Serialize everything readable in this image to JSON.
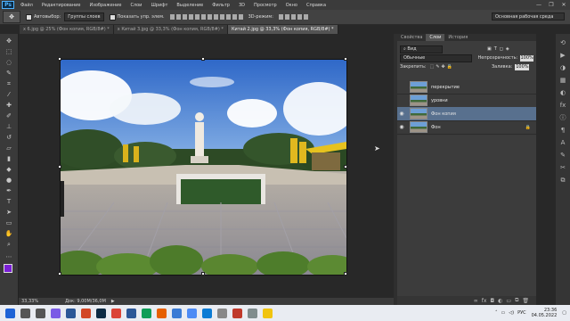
{
  "app": {
    "logo": "Ps"
  },
  "menu": [
    "Файл",
    "Редактирование",
    "Изображение",
    "Слои",
    "Шрифт",
    "Выделение",
    "Фильтр",
    "3D",
    "Просмотр",
    "Окно",
    "Справка"
  ],
  "window_controls": [
    "—",
    "❐",
    "✕"
  ],
  "options": {
    "autoselect_label": "Автовыбор:",
    "autoselect_value": "Группы слоев",
    "show_transform_label": "Показать упр. элем.",
    "mode3d_label": "3D-режим:",
    "workspace": "Основная рабочая среда"
  },
  "doc_tabs": [
    {
      "label": "х 6.jpg @ 25% (Фон копия, RGB/8#) *",
      "active": false
    },
    {
      "label": "х Китай 3.jpg @ 33,3% (Фон копия, RGB/8#) *",
      "active": false
    },
    {
      "label": "Китай 2.jpg @ 33,3% (Фон копия, RGB/8#) *",
      "active": true
    }
  ],
  "status": {
    "zoom": "33,33%",
    "doc": "Док: 9,00M/36,0M"
  },
  "panel": {
    "tabs": [
      "Свойства",
      "Слои",
      "История"
    ],
    "filter_label": "Вид",
    "blend_mode": "Обычные",
    "opacity_label": "Непрозрачность:",
    "opacity_value": "100%",
    "lock_label": "Закрепить:",
    "fill_label": "Заливка:",
    "fill_value": "100%",
    "layers": [
      {
        "name": "перекрытие",
        "visible": false,
        "selected": false
      },
      {
        "name": "уровни",
        "visible": false,
        "selected": false
      },
      {
        "name": "Фон копия",
        "visible": true,
        "selected": true
      },
      {
        "name": "Фон",
        "visible": true,
        "selected": false
      }
    ],
    "footer_icons": [
      "link-icon",
      "fx-icon",
      "mask-icon",
      "adjustment-icon",
      "folder-icon",
      "new-layer-icon",
      "trash-icon"
    ]
  },
  "taskbar": {
    "icons": [
      {
        "name": "start-icon",
        "color": "#1e63d6"
      },
      {
        "name": "search-icon",
        "color": "#555555"
      },
      {
        "name": "taskview-icon",
        "color": "#555555"
      },
      {
        "name": "assistant-icon",
        "color": "#7b5ce6"
      },
      {
        "name": "word-icon",
        "color": "#2b5797"
      },
      {
        "name": "powerpoint-icon",
        "color": "#d24726"
      },
      {
        "name": "photoshop-icon",
        "color": "#0b2a43"
      },
      {
        "name": "chrome-icon",
        "color": "#db4437"
      },
      {
        "name": "word-icon",
        "color": "#2b5797"
      },
      {
        "name": "chrome-icon",
        "color": "#0f9d58"
      },
      {
        "name": "firefox-icon",
        "color": "#e66000"
      },
      {
        "name": "files-icon",
        "color": "#3a7bd5"
      },
      {
        "name": "store-icon",
        "color": "#4c8bf5"
      },
      {
        "name": "edge-icon",
        "color": "#0c7cd5"
      },
      {
        "name": "app-icon",
        "color": "#888888"
      },
      {
        "name": "app-icon",
        "color": "#c0392b"
      },
      {
        "name": "app-icon",
        "color": "#7f8c8d"
      },
      {
        "name": "explorer-icon",
        "color": "#f1c40f"
      }
    ],
    "lang": "РУС",
    "time": "23:36",
    "date": "04.05.2022"
  }
}
